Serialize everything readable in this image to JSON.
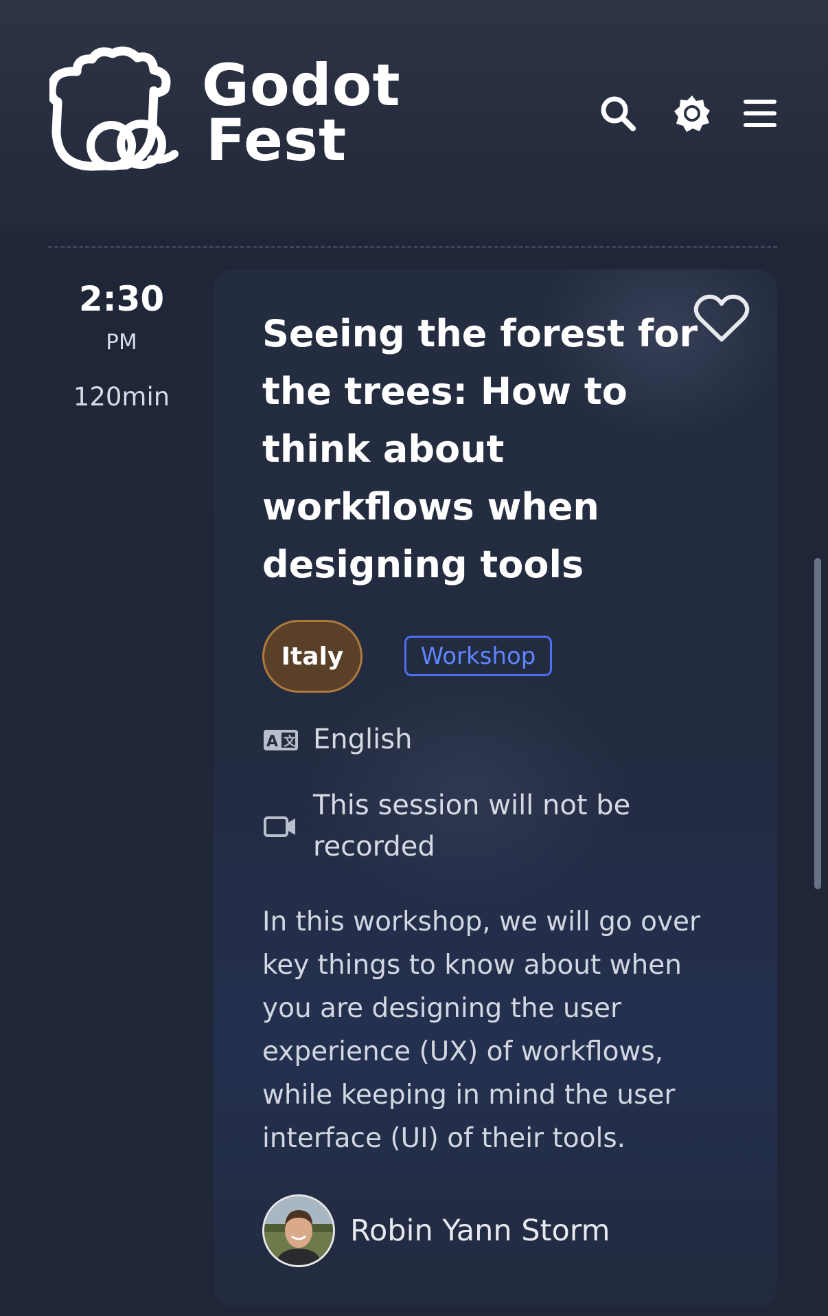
{
  "header": {
    "logo_line1": "Godot",
    "logo_line2": "Fest",
    "icons": [
      "search-icon",
      "theme-toggle-icon",
      "menu-icon"
    ]
  },
  "session": {
    "time": "2:30",
    "ampm": "PM",
    "duration": "120min",
    "title": "Seeing the forest for the trees: How to think about workflows when designing tools",
    "country_tag": "Italy",
    "type_tag": "Workshop",
    "language": "English",
    "recording": "This session will not be recorded",
    "description": "In this workshop, we will go over key things to know about when you are designing the user experience (UX) of workflows, while keeping in mind the user interface (UI) of their tools.",
    "speaker": "Robin Yann Storm"
  },
  "colors": {
    "background": "#1f2638",
    "card": "#242c40",
    "country_tag": "#5a4028",
    "type_tag": "#4a72ef"
  }
}
